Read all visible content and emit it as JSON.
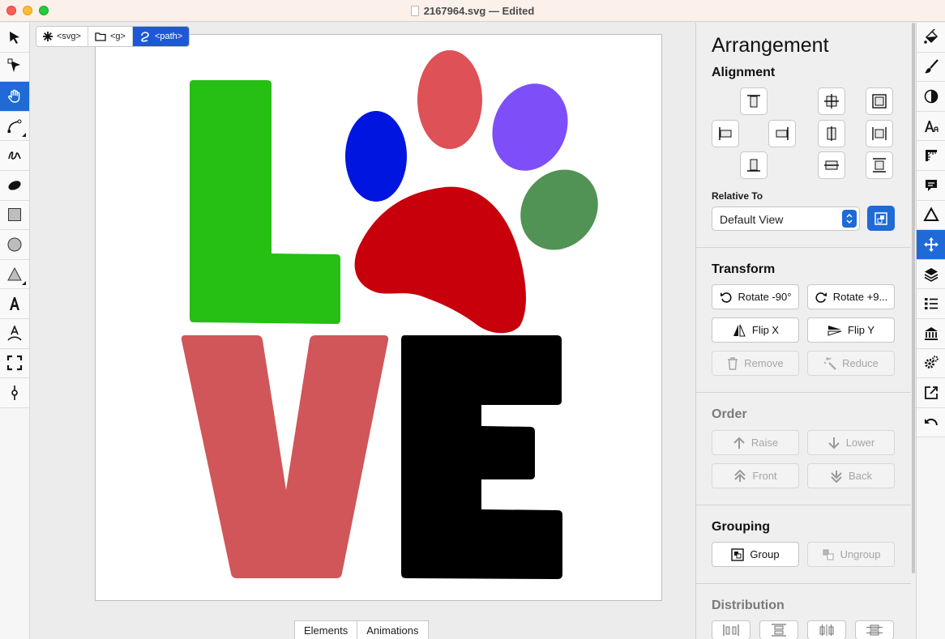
{
  "window": {
    "title": "2167964.svg — Edited"
  },
  "left_toolbar": {
    "tools": [
      {
        "name": "select-tool",
        "icon": "arrow-pointer-icon"
      },
      {
        "name": "node-tool",
        "icon": "node-arrow-icon"
      },
      {
        "name": "pan-tool",
        "icon": "hand-icon",
        "active": true
      },
      {
        "name": "pen-tool",
        "icon": "bezier-pen-icon"
      },
      {
        "name": "pencil-tool",
        "icon": "freehand-icon"
      },
      {
        "name": "brush-tool",
        "icon": "ellipse-brush-icon"
      },
      {
        "name": "rectangle-tool",
        "icon": "rectangle-icon"
      },
      {
        "name": "circle-tool",
        "icon": "circle-icon"
      },
      {
        "name": "polygon-tool",
        "icon": "triangle-icon"
      },
      {
        "name": "text-tool",
        "icon": "text-icon"
      },
      {
        "name": "text-on-path-tool",
        "icon": "text-path-icon"
      },
      {
        "name": "crop-tool",
        "icon": "crop-frame-icon"
      },
      {
        "name": "eyedropper-tool",
        "icon": "node-pin-icon"
      }
    ]
  },
  "breadcrumb": {
    "items": [
      "<svg>",
      "<g>",
      "<path>"
    ]
  },
  "bottom_tabs": [
    "Elements",
    "Animations"
  ],
  "artwork": {
    "letters": [
      "L",
      "V",
      "E"
    ],
    "colors": {
      "L": "#26bf14",
      "V": "#d05659",
      "E": "#000000",
      "paw_pad": "#c7000b",
      "toe1": "#0016e0",
      "toe2": "#de5157",
      "toe3": "#7e4ff9",
      "toe4": "#519255"
    }
  },
  "panel": {
    "title": "Arrangement",
    "alignment": {
      "heading": "Alignment",
      "relative_to_label": "Relative To",
      "relative_to_value": "Default View"
    },
    "transform": {
      "heading": "Transform",
      "rotate_ccw": "Rotate -90°",
      "rotate_cw": "Rotate +9...",
      "flip_x": "Flip X",
      "flip_y": "Flip Y",
      "remove": "Remove",
      "reduce": "Reduce"
    },
    "order": {
      "heading": "Order",
      "raise": "Raise",
      "lower": "Lower",
      "front": "Front",
      "back": "Back"
    },
    "grouping": {
      "heading": "Grouping",
      "group": "Group",
      "ungroup": "Ungroup"
    },
    "distribution": {
      "heading": "Distribution"
    }
  },
  "right_toolbar": {
    "tools": [
      "fill-bucket-icon",
      "brush-icon",
      "contrast-icon",
      "font-icon",
      "ruler-icon",
      "comment-icon",
      "triangle-outline-icon",
      "move-arrows-icon",
      "layers-icon",
      "list-icon",
      "library-icon",
      "gears-icon",
      "export-icon",
      "undo-icon"
    ],
    "active": "move-arrows-icon"
  },
  "accent_color": "#1f6ad6"
}
